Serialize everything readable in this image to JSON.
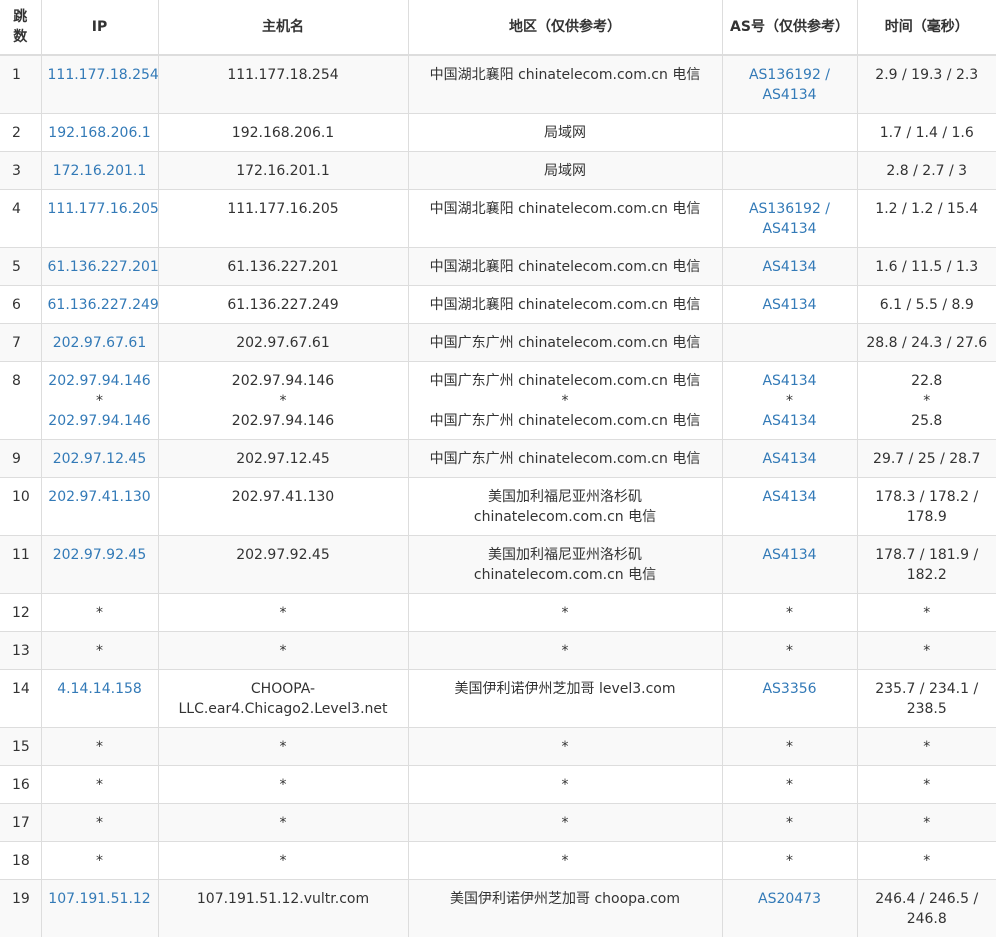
{
  "headers": {
    "hop": "跳数",
    "ip": "IP",
    "host": "主机名",
    "region": "地区（仅供参考）",
    "as": "AS号（仅供参考）",
    "time": "时间（毫秒）"
  },
  "colors": {
    "link": "#337ab7",
    "text": "#333333",
    "stripe": "#f9f9f9",
    "border": "#dddddd"
  },
  "rows": [
    {
      "hop": "1",
      "ip": [
        "111.177.18.254"
      ],
      "host": [
        "111.177.18.254"
      ],
      "region": [
        "中国湖北襄阳 chinatelecom.com.cn 电信"
      ],
      "as": [
        "AS136192 /",
        "AS4134"
      ],
      "time": [
        "2.9 / 19.3 / 2.3"
      ]
    },
    {
      "hop": "2",
      "ip": [
        "192.168.206.1"
      ],
      "host": [
        "192.168.206.1"
      ],
      "region": [
        "局域网"
      ],
      "as": [],
      "time": [
        "1.7 / 1.4 / 1.6"
      ]
    },
    {
      "hop": "3",
      "ip": [
        "172.16.201.1"
      ],
      "host": [
        "172.16.201.1"
      ],
      "region": [
        "局域网"
      ],
      "as": [],
      "time": [
        "2.8 / 2.7 / 3"
      ]
    },
    {
      "hop": "4",
      "ip": [
        "111.177.16.205"
      ],
      "host": [
        "111.177.16.205"
      ],
      "region": [
        "中国湖北襄阳 chinatelecom.com.cn 电信"
      ],
      "as": [
        "AS136192 /",
        "AS4134"
      ],
      "time": [
        "1.2 / 1.2 / 15.4"
      ]
    },
    {
      "hop": "5",
      "ip": [
        "61.136.227.201"
      ],
      "host": [
        "61.136.227.201"
      ],
      "region": [
        "中国湖北襄阳 chinatelecom.com.cn 电信"
      ],
      "as": [
        "AS4134"
      ],
      "time": [
        "1.6 / 11.5 / 1.3"
      ]
    },
    {
      "hop": "6",
      "ip": [
        "61.136.227.249"
      ],
      "host": [
        "61.136.227.249"
      ],
      "region": [
        "中国湖北襄阳 chinatelecom.com.cn 电信"
      ],
      "as": [
        "AS4134"
      ],
      "time": [
        "6.1 / 5.5 / 8.9"
      ]
    },
    {
      "hop": "7",
      "ip": [
        "202.97.67.61"
      ],
      "host": [
        "202.97.67.61"
      ],
      "region": [
        "中国广东广州 chinatelecom.com.cn 电信"
      ],
      "as": [],
      "time": [
        "28.8 / 24.3 / 27.6"
      ]
    },
    {
      "hop": "8",
      "ip": [
        "202.97.94.146",
        "*",
        "202.97.94.146"
      ],
      "host": [
        "202.97.94.146",
        "*",
        "202.97.94.146"
      ],
      "region": [
        "中国广东广州 chinatelecom.com.cn 电信",
        "*",
        "中国广东广州 chinatelecom.com.cn 电信"
      ],
      "as": [
        "AS4134",
        "*",
        "AS4134"
      ],
      "time": [
        "22.8",
        "*",
        "25.8"
      ]
    },
    {
      "hop": "9",
      "ip": [
        "202.97.12.45"
      ],
      "host": [
        "202.97.12.45"
      ],
      "region": [
        "中国广东广州 chinatelecom.com.cn 电信"
      ],
      "as": [
        "AS4134"
      ],
      "time": [
        "29.7 / 25 / 28.7"
      ]
    },
    {
      "hop": "10",
      "ip": [
        "202.97.41.130"
      ],
      "host": [
        "202.97.41.130"
      ],
      "region": [
        "美国加利福尼亚州洛杉矶",
        "chinatelecom.com.cn 电信"
      ],
      "as": [
        "AS4134"
      ],
      "time": [
        "178.3 / 178.2 /",
        "178.9"
      ]
    },
    {
      "hop": "11",
      "ip": [
        "202.97.92.45"
      ],
      "host": [
        "202.97.92.45"
      ],
      "region": [
        "美国加利福尼亚州洛杉矶",
        "chinatelecom.com.cn 电信"
      ],
      "as": [
        "AS4134"
      ],
      "time": [
        "178.7 / 181.9 /",
        "182.2"
      ]
    },
    {
      "hop": "12",
      "ip": [
        "*"
      ],
      "host": [
        "*"
      ],
      "region": [
        "*"
      ],
      "as": [
        "*"
      ],
      "time": [
        "*"
      ]
    },
    {
      "hop": "13",
      "ip": [
        "*"
      ],
      "host": [
        "*"
      ],
      "region": [
        "*"
      ],
      "as": [
        "*"
      ],
      "time": [
        "*"
      ]
    },
    {
      "hop": "14",
      "ip": [
        "4.14.14.158"
      ],
      "host": [
        "CHOOPA-",
        "LLC.ear4.Chicago2.Level3.net"
      ],
      "region": [
        "美国伊利诺伊州芝加哥 level3.com"
      ],
      "as": [
        "AS3356"
      ],
      "time": [
        "235.7 / 234.1 /",
        "238.5"
      ]
    },
    {
      "hop": "15",
      "ip": [
        "*"
      ],
      "host": [
        "*"
      ],
      "region": [
        "*"
      ],
      "as": [
        "*"
      ],
      "time": [
        "*"
      ]
    },
    {
      "hop": "16",
      "ip": [
        "*"
      ],
      "host": [
        "*"
      ],
      "region": [
        "*"
      ],
      "as": [
        "*"
      ],
      "time": [
        "*"
      ]
    },
    {
      "hop": "17",
      "ip": [
        "*"
      ],
      "host": [
        "*"
      ],
      "region": [
        "*"
      ],
      "as": [
        "*"
      ],
      "time": [
        "*"
      ]
    },
    {
      "hop": "18",
      "ip": [
        "*"
      ],
      "host": [
        "*"
      ],
      "region": [
        "*"
      ],
      "as": [
        "*"
      ],
      "time": [
        "*"
      ]
    },
    {
      "hop": "19",
      "ip": [
        "107.191.51.12"
      ],
      "host": [
        "107.191.51.12.vultr.com"
      ],
      "region": [
        "美国伊利诺伊州芝加哥 choopa.com"
      ],
      "as": [
        "AS20473"
      ],
      "time": [
        "246.4 / 246.5 /",
        "246.8"
      ]
    }
  ]
}
